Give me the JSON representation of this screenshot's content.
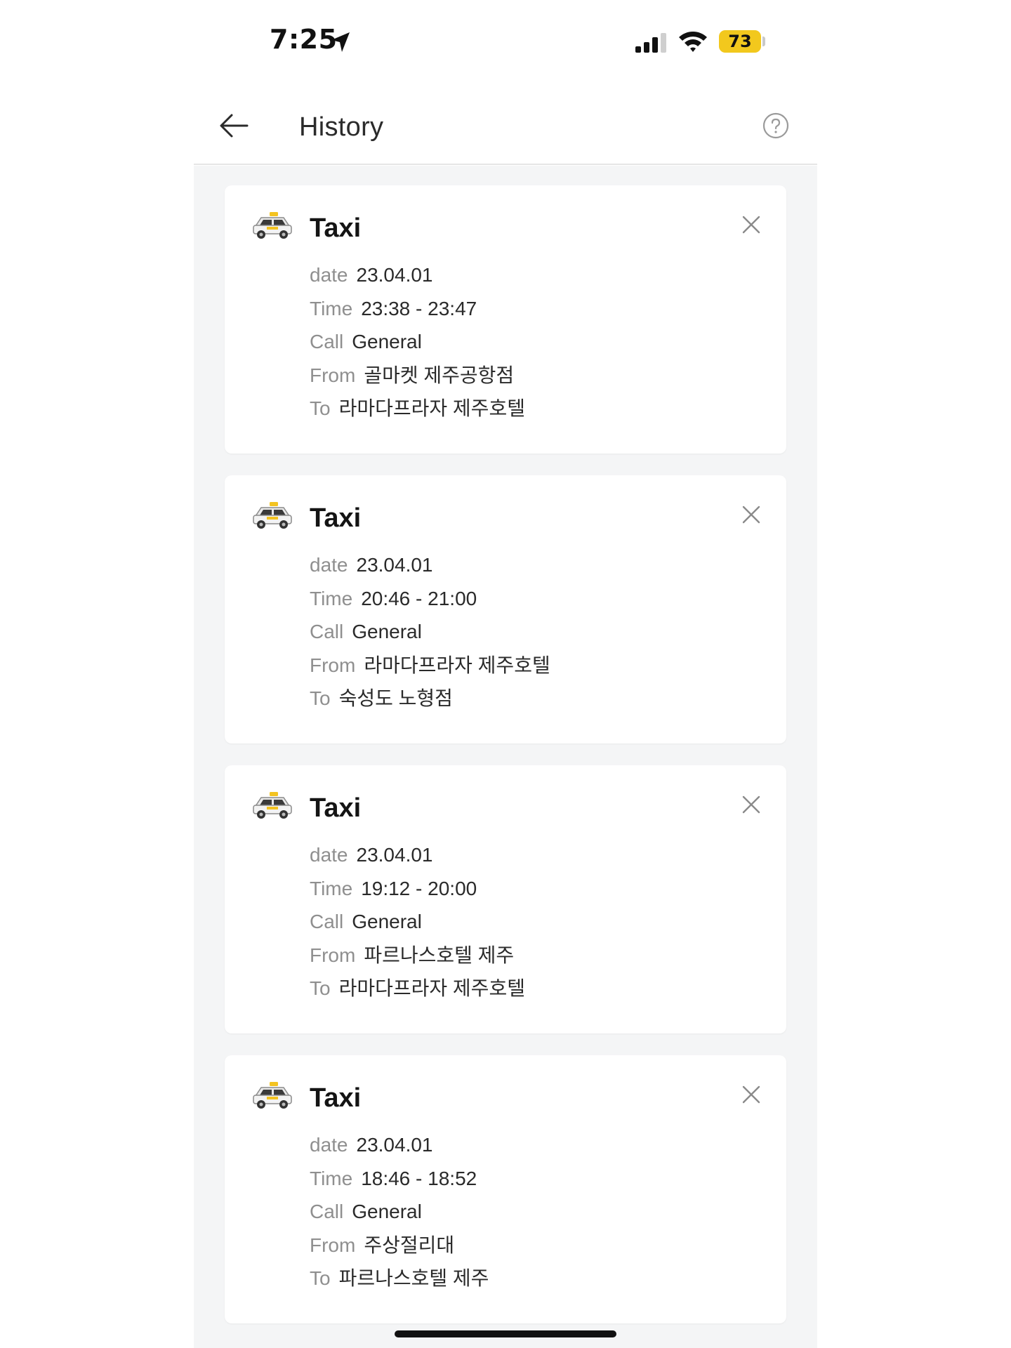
{
  "status_bar": {
    "time": "7:25",
    "battery_level": "73",
    "accent_color": "#f2c81d"
  },
  "header": {
    "title": "History",
    "back_icon": "arrow-left-icon",
    "help_icon": "question-circle-icon"
  },
  "labels": {
    "date": "date",
    "time": "Time",
    "call": "Call",
    "from": "From",
    "to": "To"
  },
  "rides": [
    {
      "type": "Taxi",
      "date": "23.04.01",
      "time": "23:38 - 23:47",
      "call": "General",
      "from": "골마켓 제주공항점",
      "to": "라마다프라자 제주호텔"
    },
    {
      "type": "Taxi",
      "date": "23.04.01",
      "time": "20:46 - 21:00",
      "call": "General",
      "from": "라마다프라자 제주호텔",
      "to": "숙성도 노형점"
    },
    {
      "type": "Taxi",
      "date": "23.04.01",
      "time": "19:12 - 20:00",
      "call": "General",
      "from": "파르나스호텔 제주",
      "to": "라마다프라자 제주호텔"
    },
    {
      "type": "Taxi",
      "date": "23.04.01",
      "time": "18:46 - 18:52",
      "call": "General",
      "from": "주상절리대",
      "to": "파르나스호텔 제주"
    }
  ]
}
